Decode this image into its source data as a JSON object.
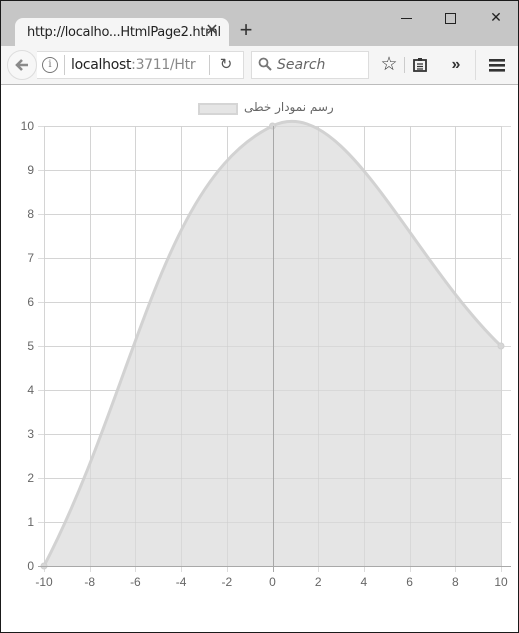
{
  "browser": {
    "tab_title": "http://localho...HtmlPage2.html",
    "tab_close_glyph": "✕",
    "new_tab_glyph": "+",
    "window_close_glyph": "✕",
    "url_host": "localhost",
    "url_rest": ":3711/Htr",
    "reload_glyph": "↻",
    "search_placeholder": "Search",
    "star_glyph": "☆",
    "overflow_glyph": "»",
    "icons": {
      "back": "back-arrow-icon",
      "info": "info-icon",
      "reload": "reload-icon",
      "search": "search-icon",
      "bookmark": "star-icon",
      "reader": "reading-list-icon",
      "overflow": "chevron-double-right-icon",
      "menu": "hamburger-menu-icon"
    }
  },
  "chart_data": {
    "type": "line",
    "fill": true,
    "interpolation": "smooth",
    "title": "",
    "legend": {
      "position": "top-center",
      "entries": [
        "رسم نمودار خطی"
      ]
    },
    "series": [
      {
        "name": "رسم نمودار خطی",
        "points": [
          {
            "x": -10,
            "y": 0
          },
          {
            "x": 0,
            "y": 10
          },
          {
            "x": 10,
            "y": 5
          }
        ],
        "fill_color": "#e5e5e5",
        "line_color": "#d2d2d2"
      }
    ],
    "xlabel": "",
    "ylabel": "",
    "xlim": [
      -10,
      10
    ],
    "ylim": [
      0,
      10
    ],
    "x_ticks": [
      -10,
      -8,
      -6,
      -4,
      -2,
      0,
      2,
      4,
      6,
      8,
      10
    ],
    "y_ticks": [
      0,
      1,
      2,
      3,
      4,
      5,
      6,
      7,
      8,
      9,
      10
    ],
    "grid": true,
    "colors": {
      "grid": "#dcdcdc",
      "zero_line": "#a8a8a8",
      "tick_text": "#666666"
    }
  }
}
